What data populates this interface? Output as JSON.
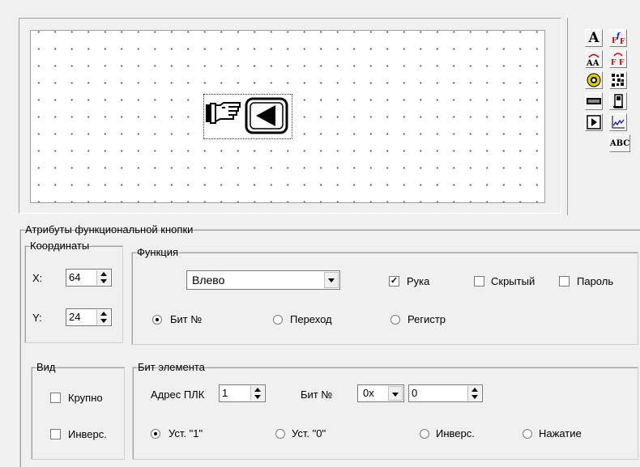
{
  "canvas": {
    "icon_hand": "pointing-hand-icon",
    "icon_arrow": "left-arrow-icon"
  },
  "toolbar": {
    "items": [
      "A",
      "F-f-F",
      "A-A",
      "F-F",
      "circle",
      "pattern",
      "keyboard",
      "door",
      "play",
      "chart",
      "ABC"
    ],
    "abc_label": "ABC",
    "a_label": "A"
  },
  "attributes": {
    "title": "Атрибуты функциональной кнопки",
    "coords": {
      "title": "Координаты",
      "x_label": "X:",
      "x_value": "64",
      "y_label": "Y:",
      "y_value": "24"
    },
    "function": {
      "title": "Функция",
      "selected": "Влево",
      "hand_label": "Рука",
      "hand_checked": true,
      "hidden_label": "Скрытый",
      "hidden_checked": false,
      "password_label": "Пароль",
      "password_checked": false,
      "radio_bit": "Бит №",
      "radio_jump": "Переход",
      "radio_register": "Регистр"
    },
    "view": {
      "title": "Вид",
      "large_label": "Крупно",
      "inverse_label": "Инверс."
    },
    "bit_element": {
      "title": "Бит элемента",
      "plc_label": "Адрес ПЛК",
      "plc_value": "1",
      "bit_label": "Бит №",
      "prefix_value": "0x",
      "bit_value": "0",
      "r_set1": "Уст. \"1\"",
      "r_set0": "Уст. \"0\"",
      "r_inverse": "Инверс.",
      "r_press": "Нажатие"
    }
  }
}
